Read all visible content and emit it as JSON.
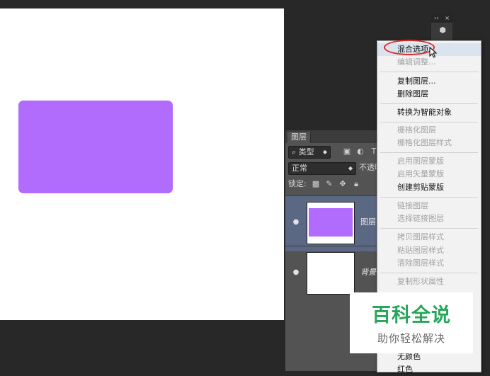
{
  "colors": {
    "shape_fill": "#b16cfd",
    "watermark_green": "#27a65a"
  },
  "layers_panel": {
    "tab_label": "图层",
    "filter": {
      "icon": "search-icon",
      "value": "类型"
    },
    "filter_icons": [
      "image-filter-icon",
      "adjustment-filter-icon",
      "text-filter-icon"
    ],
    "blend_mode": "正常",
    "opacity_label": "不透明",
    "lock_label": "锁定:",
    "lock_icons": [
      "lock-transparent-icon",
      "lock-paint-icon",
      "lock-position-icon",
      "lock-all-icon"
    ],
    "layers": [
      {
        "name": "图层",
        "selected": true,
        "visible": true
      },
      {
        "name": "背景",
        "selected": false,
        "visible": true
      }
    ]
  },
  "mini_panel": {
    "expand": "››",
    "close": "×",
    "icon": "3d-cube-icon"
  },
  "context_menu": {
    "items": [
      {
        "label": "混合选项...",
        "enabled": true,
        "highlighted": true
      },
      {
        "label": "编辑调整...",
        "enabled": false
      },
      {
        "label": "复制图层...",
        "enabled": true
      },
      {
        "label": "删除图层",
        "enabled": true
      },
      {
        "label": "转换为智能对象",
        "enabled": true
      },
      {
        "label": "栅格化图层",
        "enabled": false
      },
      {
        "label": "栅格化图层样式",
        "enabled": false
      },
      {
        "label": "启用图层蒙版",
        "enabled": false
      },
      {
        "label": "启用矢量蒙版",
        "enabled": false
      },
      {
        "label": "创建剪贴蒙版",
        "enabled": true
      },
      {
        "label": "链接图层",
        "enabled": false
      },
      {
        "label": "选择链接图层",
        "enabled": false
      },
      {
        "label": "拷贝图层样式",
        "enabled": false
      },
      {
        "label": "粘贴图层样式",
        "enabled": false
      },
      {
        "label": "清除图层样式",
        "enabled": false
      },
      {
        "label": "复制形状属性",
        "enabled": false
      },
      {
        "label": "无颜色",
        "enabled": true
      },
      {
        "label": "红色",
        "enabled": true
      }
    ]
  },
  "watermark": {
    "title": "百科全说",
    "subtitle": "助你轻松解决"
  }
}
